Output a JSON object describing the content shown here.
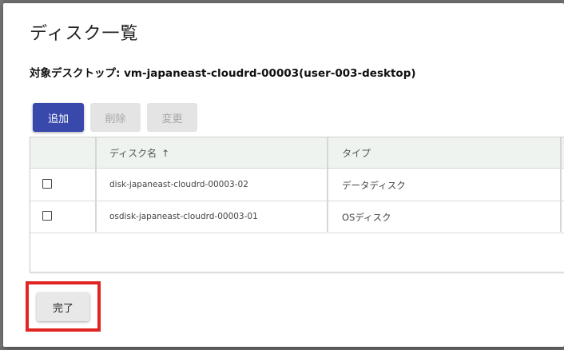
{
  "dialog": {
    "title": "ディスク一覧",
    "target_label": "対象デスクトップ: ",
    "target_value": "vm-japaneast-cloudrd-00003(user-003-desktop)"
  },
  "toolbar": {
    "add_label": "追加",
    "delete_label": "削除",
    "edit_label": "変更"
  },
  "table": {
    "headers": {
      "name": "ディスク名",
      "sort_icon": "↑",
      "type": "タイプ"
    },
    "rows": [
      {
        "name": "disk-japaneast-cloudrd-00003-02",
        "type": "データディスク"
      },
      {
        "name": "osdisk-japaneast-cloudrd-00003-01",
        "type": "OSディスク"
      }
    ]
  },
  "footer": {
    "done_label": "完了"
  },
  "colors": {
    "primary": "#3949ab",
    "highlight": "#e02424",
    "header_bg": "#eef3ef"
  }
}
